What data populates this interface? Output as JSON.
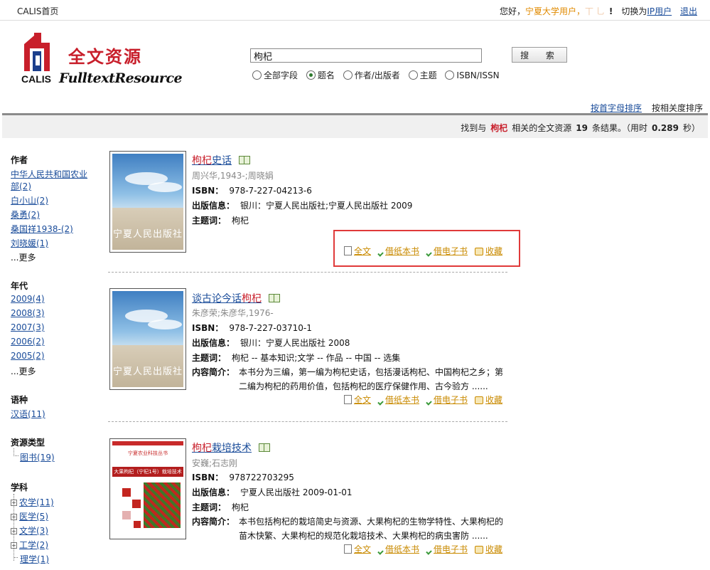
{
  "topbar": {
    "home": "CALIS首页",
    "greeting": "您好，",
    "org": "宁夏大学用户，",
    "user_hidden": "丅 乚",
    "exclaim": "!",
    "switch_prefix": "切换为",
    "switch_link": "IP用户",
    "logout": "退出"
  },
  "logo": {
    "cn": "全文资源",
    "calis": "CALIS",
    "en": "FulltextResource"
  },
  "search": {
    "value": "枸杞",
    "button": "搜 索",
    "scopes": [
      {
        "label": "全部字段",
        "selected": false
      },
      {
        "label": "题名",
        "selected": true
      },
      {
        "label": "作者/出版者",
        "selected": false
      },
      {
        "label": "主题",
        "selected": false
      },
      {
        "label": "ISBN/ISSN",
        "selected": false
      }
    ]
  },
  "sort": {
    "alpha": "按首字母排序",
    "relevance": "按相关度排序"
  },
  "result": {
    "prefix": "找到与",
    "keyword": "枸杞",
    "middle": "相关的全文资源",
    "count": "19",
    "suffix": "条结果。（用时",
    "time": "0.289",
    "unit": "秒）"
  },
  "sidebar": {
    "author_title": "作者",
    "authors": [
      "中华人民共和国农业",
      "部(2)",
      "白小山(2)",
      "桑勇(2)",
      "桑国祥1938-(2)",
      "刘晓媛(1)"
    ],
    "more": "...更多",
    "year_title": "年代",
    "years": [
      "2009(4)",
      "2008(3)",
      "2007(3)",
      "2006(2)",
      "2005(2)"
    ],
    "lang_title": "语种",
    "langs": [
      "汉语(11)"
    ],
    "type_title": "资源类型",
    "types": [
      "图书(19)"
    ],
    "subject_title": "学科",
    "subjects": [
      "农学(11)",
      "医学(5)",
      "文学(3)",
      "工学(2)",
      "理学(1)"
    ]
  },
  "labels": {
    "isbn": "ISBN：",
    "pub": "出版信息：",
    "subject": "主题词：",
    "abstract": "内容简介：",
    "fulltext": "全文",
    "borrow_paper": "借纸本书",
    "borrow_ebook": "借电子书",
    "favorite": "收藏"
  },
  "items": [
    {
      "title_hl": "枸杞",
      "title_rest": "史话",
      "author": "周兴华,1943-;周晓娟",
      "isbn": "978-7-227-04213-6",
      "pub": "银川：宁夏人民出版社;宁夏人民出版社 2009",
      "subject": "枸杞",
      "cover_text": "宁夏人民出版社"
    },
    {
      "title_pre": "谈古论今话",
      "title_hl": "枸杞",
      "author": "朱彦荣;朱彦华,1976-",
      "isbn": "978-7-227-03710-1",
      "pub": "银川：宁夏人民出版社 2008",
      "subject": "枸杞 -- 基本知识;文学 -- 作品 -- 中国 -- 选集",
      "abstract_1": "本书分为三编，第一编为枸杞史话，包括漫话枸杞、中国枸杞之乡；第",
      "abstract_2": "二编为枸杞的药用价值，包括枸杞的医疗保健作用、古今验方 ......",
      "cover_text": "宁夏人民出版社"
    },
    {
      "title_hl": "枸杞",
      "title_rest": "栽培技术",
      "author": "安巍;石志刚",
      "isbn": "978722703295",
      "pub": "宁夏人民出版社 2009-01-01",
      "subject": "枸杞",
      "abstract_1": "本书包括枸杞的栽培简史与资源、大果枸杞的生物学特性、大果枸杞的",
      "abstract_2": "苗木快繁、大果枸杞的规范化栽培技术、大果枸杞的病虫害防 ......",
      "cover_top": "宁夏农业科技丛书",
      "cover_title": "大果枸杞（宁杞1号）栽培技术"
    }
  ]
}
